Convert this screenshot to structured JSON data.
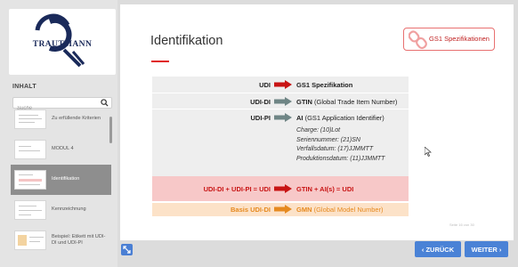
{
  "logo": {
    "text": "TRAUTMANN"
  },
  "sidebar": {
    "heading": "INHALT",
    "search_placeholder": "Suche",
    "items": [
      {
        "label": "Zu erfüllende Kriterien",
        "active": false
      },
      {
        "label": "MODUL 4",
        "active": false
      },
      {
        "label": "Identifikation",
        "active": true
      },
      {
        "label": "Kennzeichnung",
        "active": false
      },
      {
        "label": "Beispiel: Etikett mit UDI-DI und UDI-PI",
        "active": false
      }
    ]
  },
  "main": {
    "title": "Identifikation",
    "gs1_button": "GS1 Spezifikationen",
    "table": {
      "udi": {
        "label": "UDI",
        "value": "GS1 Spezifikation"
      },
      "udi_di": {
        "label": "UDI-DI",
        "value_bold": "GTIN",
        "value_rest": " (Global Trade Item Number)"
      },
      "udi_pi": {
        "label": "UDI-PI",
        "value_bold": "AI",
        "value_rest": " (GS1 Application Identifier)",
        "details": [
          "Charge: (10)Lot",
          "Seriennummer: (21)SN",
          "Verfallsdatum: (17)JJMMTT",
          "Produktionsdatum: (11)JJMMTT"
        ]
      },
      "combined": {
        "label": "UDI-DI + UDI-PI = UDI",
        "value": "GTIN + AI(s) = UDI"
      },
      "basis": {
        "label": "Basis UDI-DI",
        "value_bold": "GMN",
        "value_rest": " (Global Model Number)"
      }
    },
    "page_number": "Seite 16 von 30"
  },
  "nav": {
    "back": "ZURÜCK",
    "next": "WEITER"
  },
  "colors": {
    "accent_red": "#c81414",
    "arrow_gray": "#6f8585",
    "orange": "#e68a20",
    "nav_blue": "#4a82d6"
  }
}
